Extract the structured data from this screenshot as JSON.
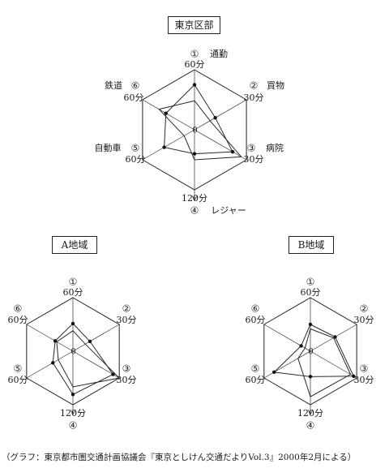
{
  "caption": "（グラフ：東京都市圏交通計画協議会『東京としけん交通だよりVol.3』2000年2月による）",
  "chart_data": [
    {
      "type": "radar",
      "title": "東京区部",
      "axes": [
        {
          "num": "①",
          "name": "通勤",
          "scale": "60分",
          "max": 60
        },
        {
          "num": "②",
          "name": "買物",
          "scale": "30分",
          "max": 30
        },
        {
          "num": "③",
          "name": "病院",
          "scale": "30分",
          "max": 30
        },
        {
          "num": "④",
          "name": "レジャー",
          "scale": "120分",
          "max": 120
        },
        {
          "num": "⑤",
          "name": "自動車",
          "scale": "60分",
          "max": 60
        },
        {
          "num": "⑥",
          "name": "鉄道",
          "scale": "60分",
          "max": 60
        }
      ],
      "center_label": "0",
      "series": [
        {
          "values": [
            45,
            12,
            22,
            48,
            35,
            33
          ],
          "marker": "dot"
        },
        {
          "values": [
            29,
            9,
            27,
            60,
            12,
            41
          ]
        }
      ]
    },
    {
      "type": "radar",
      "title": "A地域",
      "axes": [
        {
          "num": "①",
          "name": "",
          "scale": "60分",
          "max": 60
        },
        {
          "num": "②",
          "name": "",
          "scale": "30分",
          "max": 30
        },
        {
          "num": "③",
          "name": "",
          "scale": "30分",
          "max": 30
        },
        {
          "num": "④",
          "name": "",
          "scale": "120分",
          "max": 120
        },
        {
          "num": "⑤",
          "name": "",
          "scale": "60分",
          "max": 60
        },
        {
          "num": "⑥",
          "name": "",
          "scale": "60分",
          "max": 60
        }
      ],
      "center_label": "0",
      "series": [
        {
          "values": [
            31,
            11,
            26,
            97,
            26,
            23
          ],
          "marker": "dot"
        },
        {
          "values": [
            23,
            8,
            30,
            80,
            19,
            21
          ]
        }
      ]
    },
    {
      "type": "radar",
      "title": "B地域",
      "axes": [
        {
          "num": "①",
          "name": "",
          "scale": "60分",
          "max": 60
        },
        {
          "num": "②",
          "name": "",
          "scale": "30分",
          "max": 30
        },
        {
          "num": "③",
          "name": "",
          "scale": "30分",
          "max": 30
        },
        {
          "num": "④",
          "name": "",
          "scale": "120分",
          "max": 120
        },
        {
          "num": "⑤",
          "name": "",
          "scale": "60分",
          "max": 60
        },
        {
          "num": "⑥",
          "name": "",
          "scale": "60分",
          "max": 60
        }
      ],
      "center_label": "0",
      "series": [
        {
          "values": [
            30,
            16,
            28,
            57,
            47,
            12
          ],
          "marker": "dot"
        },
        {
          "values": [
            25,
            15,
            26,
            102,
            16,
            7
          ]
        }
      ]
    }
  ]
}
